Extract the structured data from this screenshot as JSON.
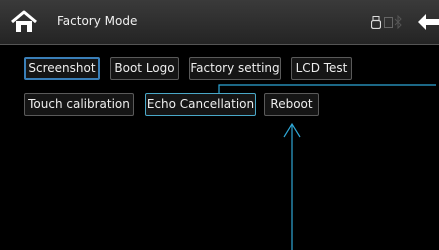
{
  "header": {
    "title": "Factory Mode"
  },
  "buttons": {
    "screenshot": "Screenshot",
    "boot_logo": "Boot Logo",
    "factory_setting": "Factory setting",
    "lcd_test": "LCD Test",
    "touch_calibration": "Touch calibration",
    "echo_cancellation": "Echo Cancellation",
    "reboot": "Reboot"
  },
  "colors": {
    "accent": "#3a7fb8",
    "annotation": "#2ea7d6",
    "background": "#000000"
  },
  "icons": [
    "home-icon",
    "usb-icon",
    "sd-card-icon",
    "bluetooth-icon",
    "back-arrow-icon"
  ]
}
